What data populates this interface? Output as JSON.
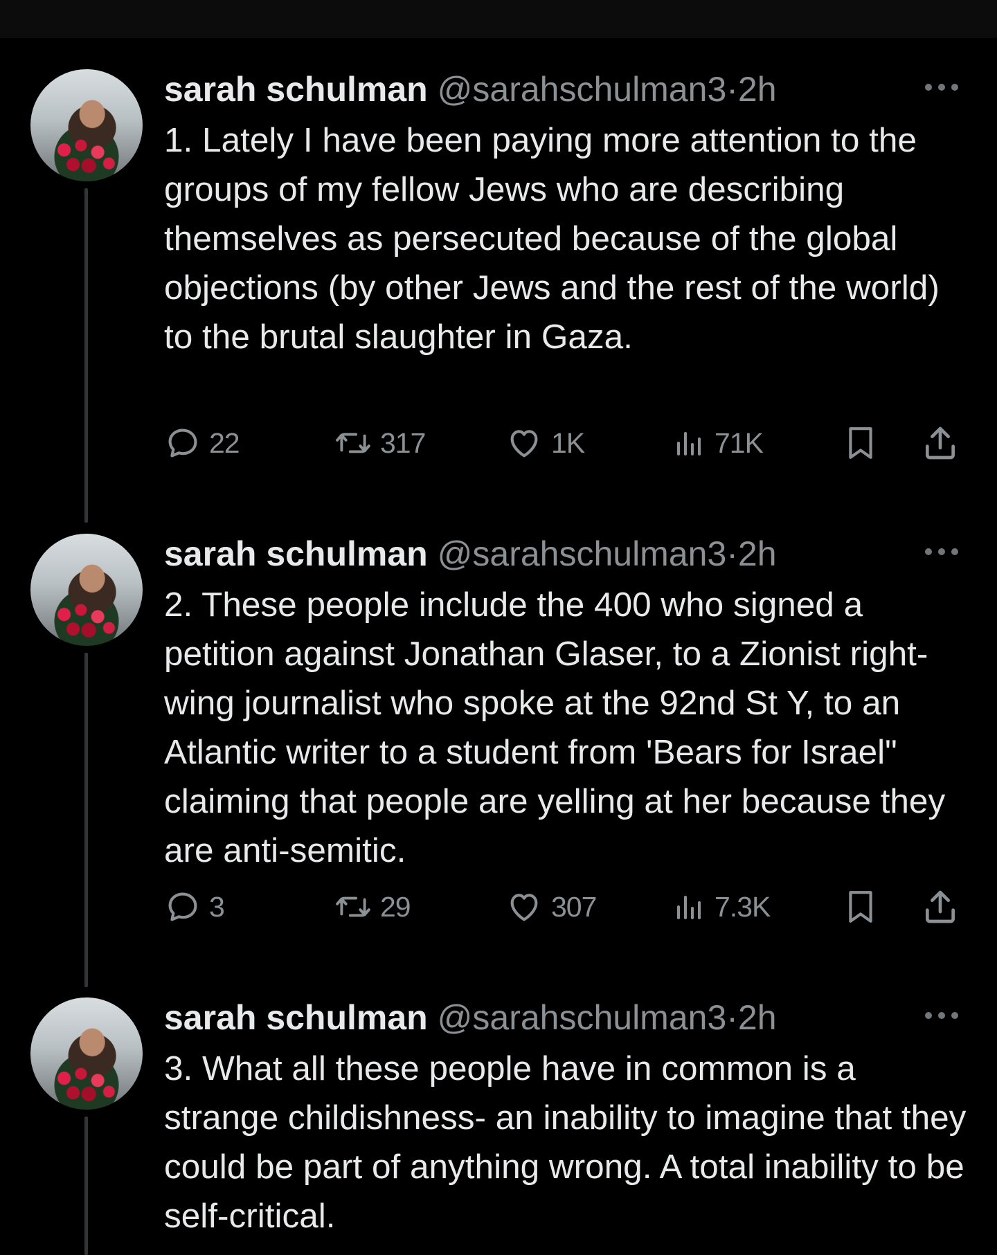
{
  "tweets": [
    {
      "name": "sarah schulman",
      "handle": "@sarahschulman3",
      "time": "2h",
      "text": "1. Lately I have been paying more attention to the groups of my fellow Jews who are describing themselves as persecuted because of the global objections (by other Jews and the rest of the world) to the brutal slaughter in Gaza.",
      "replies": "22",
      "reposts": "317",
      "likes": "1K",
      "views": "71K"
    },
    {
      "name": "sarah schulman",
      "handle": "@sarahschulman3",
      "time": "2h",
      "text": "2. These people include the 400 who signed a petition against Jonathan Glaser, to a Zionist right-wing journalist who spoke at the 92nd St Y, to an Atlantic writer to a student from 'Bears for Israel\" claiming that people are yelling at her because they are anti-semitic.",
      "replies": "3",
      "reposts": "29",
      "likes": "307",
      "views": "7.3K"
    },
    {
      "name": "sarah schulman",
      "handle": "@sarahschulman3",
      "time": "2h",
      "text": "3. What all these people have in common is a strange childishness- an inability to imagine that they could be part of anything wrong. A total inability to be self-critical."
    }
  ],
  "icons": {
    "reply": "reply-icon",
    "repost": "repost-icon",
    "like": "heart-icon",
    "views": "views-icon",
    "bookmark": "bookmark-icon",
    "share": "share-icon",
    "more": "more-icon"
  },
  "colors": {
    "background": "#000000",
    "text": "#e7e9ea",
    "muted": "#71767b",
    "thread_line": "#333639"
  }
}
